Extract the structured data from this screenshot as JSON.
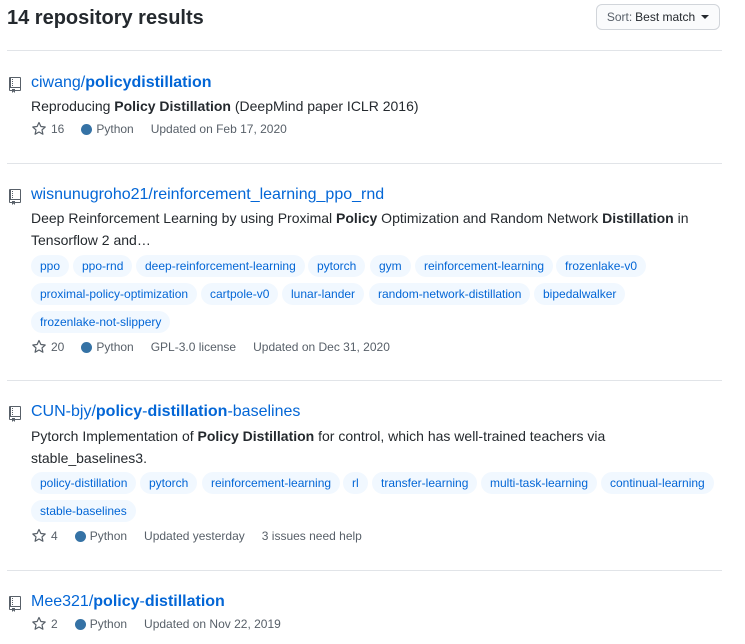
{
  "header": {
    "results_title": "14 repository results",
    "sort_prefix": "Sort:",
    "sort_value": "Best match"
  },
  "repos": [
    {
      "owner": "ciwang/",
      "name": "policydistillation",
      "description_parts": [
        "Reproducing ",
        "Policy Distillation",
        " (DeepMind paper ICLR 2016)"
      ],
      "stars": "16",
      "language": "Python",
      "language_color": "#3572a5",
      "updated": "Updated on Feb 17, 2020"
    },
    {
      "owner": "wisnunugroho21/",
      "name": "reinforcement_learning_ppo_rnd",
      "description_line1": [
        "Deep Reinforcement Learning by using Proximal ",
        "Policy",
        " Optimization and Random Network ",
        "Distillation",
        " in"
      ],
      "description_line2": "Tensorflow 2 and…",
      "topics": [
        "ppo",
        "ppo-rnd",
        "deep-reinforcement-learning",
        "pytorch",
        "gym",
        "reinforcement-learning",
        "frozenlake-v0",
        "proximal-policy-optimization",
        "cartpole-v0",
        "lunar-lander",
        "random-network-distillation",
        "bipedalwalker",
        "frozenlake-not-slippery"
      ],
      "stars": "20",
      "language": "Python",
      "license": "GPL-3.0 license",
      "updated": "Updated on Dec 31, 2020"
    },
    {
      "owner": "CUN-bjy/",
      "name_parts": [
        "policy",
        "-",
        "distillation",
        "-baselines"
      ],
      "description_line1": [
        "Pytorch Implementation of ",
        "Policy Distillation",
        " for control, which has well-trained teachers via"
      ],
      "description_line2": "stable_baselines3.",
      "topics": [
        "policy-distillation",
        "pytorch",
        "reinforcement-learning",
        "rl",
        "transfer-learning",
        "multi-task-learning",
        "continual-learning",
        "stable-baselines"
      ],
      "stars": "4",
      "language": "Python",
      "updated": "Updated yesterday",
      "issues": "3 issues need help"
    },
    {
      "owner": "Mee321/",
      "name_parts": [
        "policy",
        "-",
        "distillation"
      ],
      "stars": "2",
      "language": "Python",
      "updated": "Updated on Nov 22, 2019"
    }
  ],
  "colors": {
    "link": "#0366d6",
    "topic_bg": "#f1f8ff",
    "python": "#3572a5",
    "muted": "#586069",
    "border": "#e1e4e8"
  }
}
